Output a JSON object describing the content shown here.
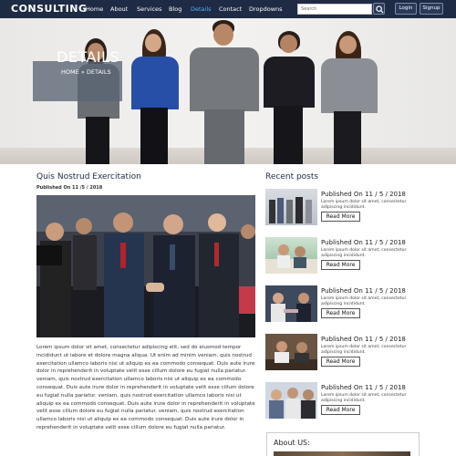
{
  "nav": {
    "brand": "CONSULTING",
    "items": [
      {
        "label": "Home",
        "active": false
      },
      {
        "label": "About",
        "active": false
      },
      {
        "label": "Services",
        "active": false
      },
      {
        "label": "Blog",
        "active": false
      },
      {
        "label": "Details",
        "active": true
      },
      {
        "label": "Contact",
        "active": false
      },
      {
        "label": "Dropdowns",
        "active": false
      }
    ],
    "search_placeholder": "Search",
    "search_icon": "search-icon",
    "login_label": "Login",
    "signup_label": "Signup"
  },
  "hero": {
    "title": "DETAILS",
    "breadcrumb_home": "HOME",
    "breadcrumb_separator": "»",
    "breadcrumb_current": "DETAILS"
  },
  "article": {
    "title": "Quis Nostrud Exercitation",
    "date": "Published On 11 /5 / 2018",
    "body": "Lorem ipsum dolor sit amet, consectetur adipiscing elit, sed do eiusmod tempor incididunt ut labore et dolore magna aliqua. Ut enim ad minim veniam, quis nostrud exercitation ullamco laboris nisi ut aliquip ex ea commodo consequat. Duis aute irure dolor in reprehenderit in voluptate velit esse cillum dolore eu fugiat nulla pariatur. veniam, quis nostrud exercitation ullamco laboris nisi ut aliquip ex ea commodo consequat. Duis aute irure dolor in reprehenderit in voluptate velit esse cillum dolore eu fugiat nulla pariatur. veniam, quis nostrud exercitation ullamco laboris nisi ut aliquip ex ea commodo consequat. Duis aute irure dolor in reprehenderit in voluptate velit esse cillum dolore eu fugiat nulla pariatur. veniam, quis nostrud exercitation ullamco laboris nisi ut aliquip ex ea commodo consequat. Duis aute irure dolor in reprehenderit in voluptate velit esse cillum dolore eu fugiat nulla pariatur."
  },
  "recent": {
    "title": "Recent posts",
    "posts": [
      {
        "date": "Published On 11 / 5 / 2018",
        "desc": "Lorem ipsum dolor sit amet, consectetur adipiscing incididunt.",
        "button": "Read More"
      },
      {
        "date": "Published On 11 / 5 / 2018",
        "desc": "Lorem ipsum dolor sit amet, consectetur adipiscing incididunt.",
        "button": "Read More"
      },
      {
        "date": "Published On 11 / 5 / 2018",
        "desc": "Lorem ipsum dolor sit amet, consectetur adipiscing incididunt.",
        "button": "Read More"
      },
      {
        "date": "Published On 11 / 5 / 2018",
        "desc": "Lorem ipsum dolor sit amet, consectetur adipiscing incididunt.",
        "button": "Read More"
      },
      {
        "date": "Published On 11 / 5 / 2018",
        "desc": "Lorem ipsum dolor sit amet, consectetur adipiscing incididunt.",
        "button": "Read More"
      }
    ]
  },
  "about": {
    "title": "About US:"
  },
  "colors": {
    "navbar": "#1f2a44",
    "active_link": "#4fb3ff",
    "heading": "#1f2a44"
  }
}
